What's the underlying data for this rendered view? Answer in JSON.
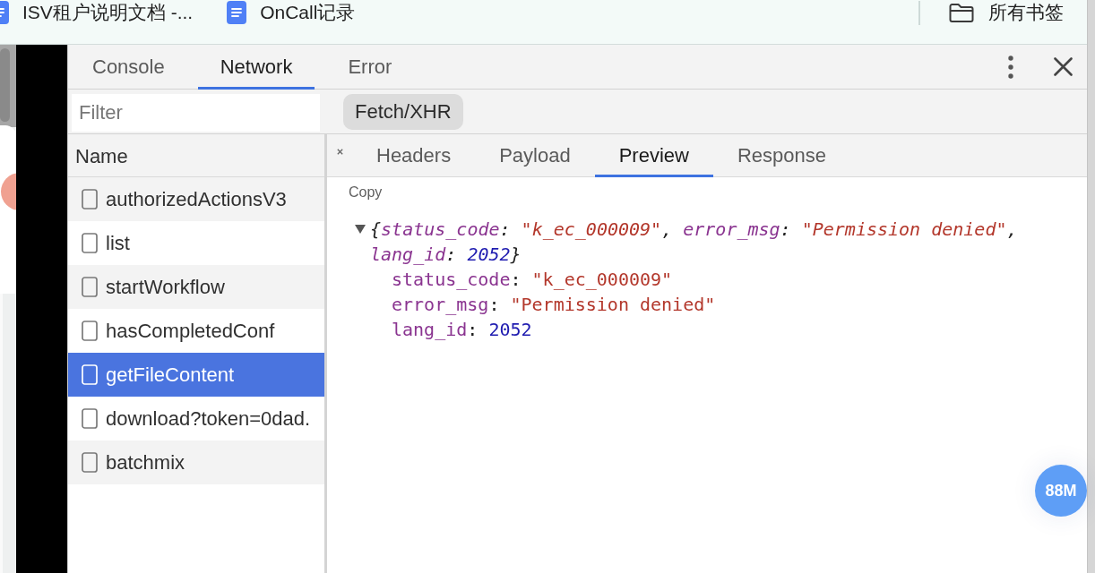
{
  "bookmarks_bar": {
    "items": [
      {
        "kind": "doc",
        "label": "ISV租户说明文档 -..."
      },
      {
        "kind": "doc",
        "label": "OnCall记录"
      }
    ],
    "all_bookmarks": {
      "kind": "folder",
      "label": "所有书签"
    }
  },
  "devtools": {
    "tabs": [
      {
        "label": "Console",
        "selected": false
      },
      {
        "label": "Network",
        "selected": true
      },
      {
        "label": "Error",
        "selected": false
      }
    ],
    "filter": {
      "placeholder": "Filter"
    },
    "filter_chips": [
      {
        "label": "Fetch/XHR",
        "selected": true
      }
    ],
    "requests": {
      "column_header": "Name",
      "rows": [
        {
          "name": "authorizedActionsV3",
          "selected": false
        },
        {
          "name": "list",
          "selected": false
        },
        {
          "name": "startWorkflow",
          "selected": false
        },
        {
          "name": "hasCompletedConf",
          "selected": false
        },
        {
          "name": "getFileContent",
          "selected": true
        },
        {
          "name": "download?token=0dad.",
          "selected": false
        },
        {
          "name": "batchmix",
          "selected": false
        }
      ]
    },
    "detail_tabs": [
      {
        "label": "Headers",
        "selected": false
      },
      {
        "label": "Payload",
        "selected": false
      },
      {
        "label": "Preview",
        "selected": true
      },
      {
        "label": "Response",
        "selected": false
      }
    ],
    "preview": {
      "copy_label": "Copy",
      "object": {
        "expanded": true,
        "summary": [
          {
            "text": "{",
            "kind": "punct"
          },
          {
            "text": "status_code",
            "kind": "key"
          },
          {
            "text": ": ",
            "kind": "punct"
          },
          {
            "text": "\"k_ec_000009\"",
            "kind": "string"
          },
          {
            "text": ", ",
            "kind": "punct"
          },
          {
            "text": "error_msg",
            "kind": "key"
          },
          {
            "text": ": ",
            "kind": "punct"
          },
          {
            "text": "\"Permission denied\"",
            "kind": "string"
          },
          {
            "text": ", ",
            "kind": "punct"
          },
          {
            "text": "lang_id",
            "kind": "key"
          },
          {
            "text": ": ",
            "kind": "punct"
          },
          {
            "text": "2052",
            "kind": "number"
          },
          {
            "text": "}",
            "kind": "punct"
          }
        ],
        "properties": [
          {
            "key": "status_code",
            "separator": ": ",
            "value": "\"k_ec_000009\"",
            "kind": "string"
          },
          {
            "key": "error_msg",
            "separator": ": ",
            "value": "\"Permission denied\"",
            "kind": "string"
          },
          {
            "key": "lang_id",
            "separator": ": ",
            "value": "2052",
            "kind": "number"
          }
        ]
      }
    }
  },
  "memory_badge": {
    "label": "88M"
  }
}
